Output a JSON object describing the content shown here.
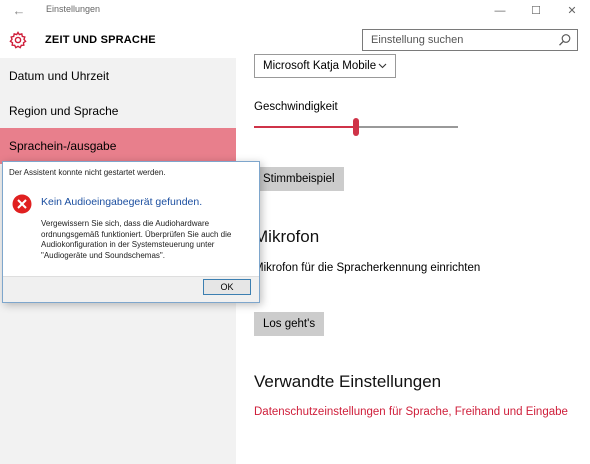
{
  "window": {
    "title": "Einstellungen",
    "back_icon": "←",
    "minimize_icon": "—",
    "maximize_icon": "☐",
    "close_icon": "✕"
  },
  "header": {
    "title": "ZEIT UND SPRACHE",
    "icon": "gear-icon",
    "accent_color": "#cf1e3a"
  },
  "search": {
    "placeholder": "Einstellung suchen",
    "icon": "search-icon"
  },
  "sidebar": {
    "items": [
      {
        "label": "Datum und Uhrzeit",
        "active": false
      },
      {
        "label": "Region und Sprache",
        "active": false
      },
      {
        "label": "Sprachein-/ausgabe",
        "active": true
      }
    ],
    "active_color": "#e87f8c"
  },
  "main": {
    "voice_select": {
      "value": "Microsoft Katja Mobile",
      "icon": "chevron-down-icon"
    },
    "speed": {
      "label": "Geschwindigkeit",
      "value_fraction": 0.5
    },
    "sample_button": "Stimmbeispiel",
    "microphone": {
      "title": "Mikrofon",
      "description": "Mikrofon für die Spracherkennung einrichten",
      "button": "Los geht's"
    },
    "related": {
      "title": "Verwandte Einstellungen",
      "link": "Datenschutzeinstellungen für Sprache, Freihand und Eingabe"
    }
  },
  "dialog": {
    "header": "Der Assistent konnte nicht gestartet werden.",
    "title": "Kein Audioeingabegerät gefunden.",
    "body": "Vergewissern Sie sich, dass die Audiohardware ordnungsgemäß funktioniert. Überprüfen Sie auch die Audiokonfiguration in der Systemsteuerung unter \"Audiogeräte und Soundschemas\".",
    "ok_button": "OK",
    "icon": "error-icon",
    "icon_color": "#e02020"
  }
}
